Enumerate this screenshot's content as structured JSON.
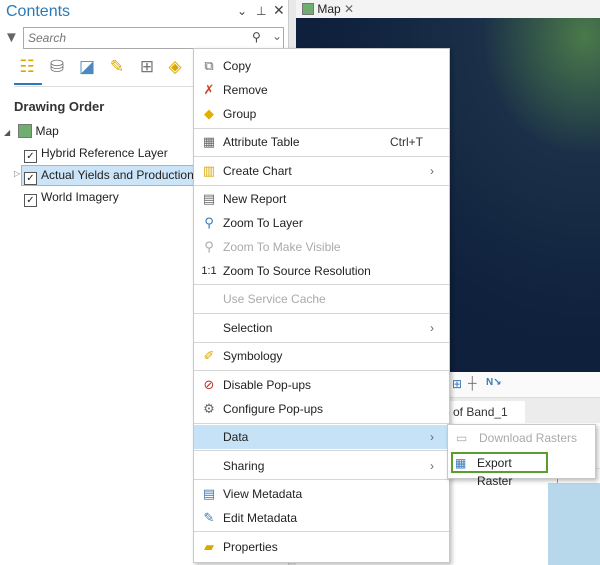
{
  "contents": {
    "title": "Contents",
    "search_placeholder": "Search",
    "heading": "Drawing Order",
    "map": "Map",
    "layers": [
      "Hybrid Reference Layer",
      "Actual Yields and Production",
      "World Imagery"
    ]
  },
  "map_view": {
    "tab": "Map",
    "chart_tab": "of Band_1"
  },
  "context_menu": {
    "items": [
      {
        "label": "Copy",
        "icon": "copy-icon"
      },
      {
        "label": "Remove",
        "icon": "remove-icon"
      },
      {
        "label": "Group",
        "icon": "group-icon"
      },
      {
        "label": "Attribute Table",
        "shortcut": "Ctrl+T",
        "icon": "table-icon"
      },
      {
        "label": "Create Chart",
        "icon": "chart-icon"
      },
      {
        "label": "New Report",
        "icon": "report-icon"
      },
      {
        "label": "Zoom To Layer",
        "icon": "zoom-icon"
      },
      {
        "label": "Zoom To Make Visible",
        "disabled": true
      },
      {
        "label": "Zoom To Source Resolution",
        "icon": "1:1"
      },
      {
        "label": "Use Service Cache",
        "disabled": true
      },
      {
        "label": "Selection"
      },
      {
        "label": "Symbology",
        "icon": "symbology-icon"
      },
      {
        "label": "Disable Pop-ups"
      },
      {
        "label": "Configure Pop-ups"
      },
      {
        "label": "Data",
        "highlighted": true
      },
      {
        "label": "Sharing"
      },
      {
        "label": "View Metadata"
      },
      {
        "label": "Edit Metadata"
      },
      {
        "label": "Properties"
      }
    ]
  },
  "submenu": {
    "items": [
      {
        "label": "Download Rasters",
        "disabled": true
      },
      {
        "label": "Export Raster",
        "highlighted_box_color": "#5a9e2f"
      }
    ]
  }
}
